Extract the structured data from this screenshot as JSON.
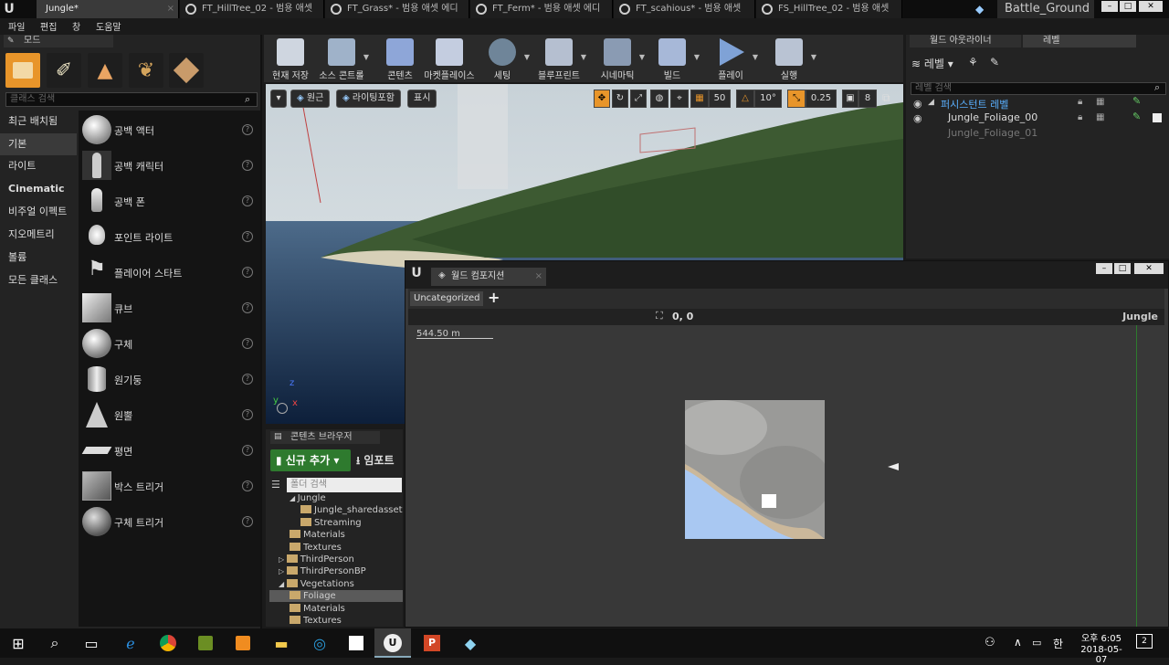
{
  "window": {
    "tabs": [
      {
        "label": "Jungle*",
        "active": true
      },
      {
        "label": "FT_HillTree_02 - 범용 애셋",
        "active": false
      },
      {
        "label": "FT_Grass* - 범용 애셋 에디",
        "active": false
      },
      {
        "label": "FT_Ferm* - 범용 애셋 에디",
        "active": false
      },
      {
        "label": "FT_scahious* - 범용 애셋 ",
        "active": false
      },
      {
        "label": "FS_HillTree_02 - 범용 애셋",
        "active": false
      }
    ],
    "project": "Battle_Ground"
  },
  "menu": [
    "파일",
    "편집",
    "창",
    "도움말"
  ],
  "modes_panel": {
    "tab": "모드",
    "search_placeholder": "클래스 검색",
    "categories": [
      "최근 배치됨",
      "기본",
      "라이트",
      "Cinematic",
      "비주얼 이펙트",
      "지오메트리",
      "볼륨",
      "모든 클래스"
    ],
    "selected_category": "기본",
    "items": [
      "공백 액터",
      "공백 캐릭터",
      "공백 폰",
      "포인트 라이트",
      "플레이어 스타트",
      "큐브",
      "구체",
      "원기둥",
      "원뿔",
      "평면",
      "박스 트리거",
      "구체 트리거"
    ],
    "help_glyph": "?"
  },
  "toolbar": [
    "현재 저장",
    "소스 콘트롤",
    "콘텐츠",
    "마켓플레이스",
    "세팅",
    "블루프린트",
    "시네마틱",
    "빌드",
    "플레이",
    "실행"
  ],
  "viewport": {
    "view_menu": "▾",
    "perspective": "원근",
    "lighting": "라이팅포함",
    "show": "표시",
    "grid_snap": "50",
    "rotation_snap": "10°",
    "scale_snap": "0.25",
    "camera_speed": "8",
    "axis_x": "x",
    "axis_y": "y",
    "axis_z": "z"
  },
  "content_browser": {
    "tab": "콘텐츠 브라우저",
    "add_new": "신규 추가",
    "import": "임포트",
    "search_placeholder": "폴더 검색",
    "tree": [
      {
        "label": "Jungle",
        "indent": 2,
        "arrow": "◢",
        "folder": false
      },
      {
        "label": "Jungle_sharedassets",
        "indent": 3,
        "arrow": "",
        "folder": true
      },
      {
        "label": "Streaming",
        "indent": 3,
        "arrow": "",
        "folder": true
      },
      {
        "label": "Materials",
        "indent": 2,
        "arrow": "",
        "folder": true
      },
      {
        "label": "Textures",
        "indent": 2,
        "arrow": "",
        "folder": true
      },
      {
        "label": "ThirdPerson",
        "indent": 1,
        "arrow": "▷",
        "folder": true
      },
      {
        "label": "ThirdPersonBP",
        "indent": 1,
        "arrow": "▷",
        "folder": true
      },
      {
        "label": "Vegetations",
        "indent": 1,
        "arrow": "◢",
        "folder": true
      },
      {
        "label": "Foliage",
        "indent": 2,
        "arrow": "",
        "folder": true,
        "selected": true
      },
      {
        "label": "Materials",
        "indent": 2,
        "arrow": "",
        "folder": true
      },
      {
        "label": "Textures",
        "indent": 2,
        "arrow": "",
        "folder": true
      }
    ]
  },
  "outliner": {
    "tabs": [
      "월드 아웃라이너",
      "레벨"
    ],
    "levels_menu": "레벨",
    "search_placeholder": "레벨 검색",
    "levels": [
      {
        "name": "퍼시스턴트 레벨",
        "kind": "persistent"
      },
      {
        "name": "Jungle_Foliage_00",
        "kind": "loaded"
      },
      {
        "name": "Jungle_Foliage_01",
        "kind": "unloaded"
      }
    ]
  },
  "world_composition": {
    "tab": "월드 컴포지션",
    "layer": "Uncategorized",
    "add_layer": "+",
    "coords": "0, 0",
    "world": "Jungle",
    "scale": "544.50 m"
  },
  "taskbar": {
    "time": "오후 6:05",
    "date": "2018-05-07",
    "notifications": "2"
  }
}
